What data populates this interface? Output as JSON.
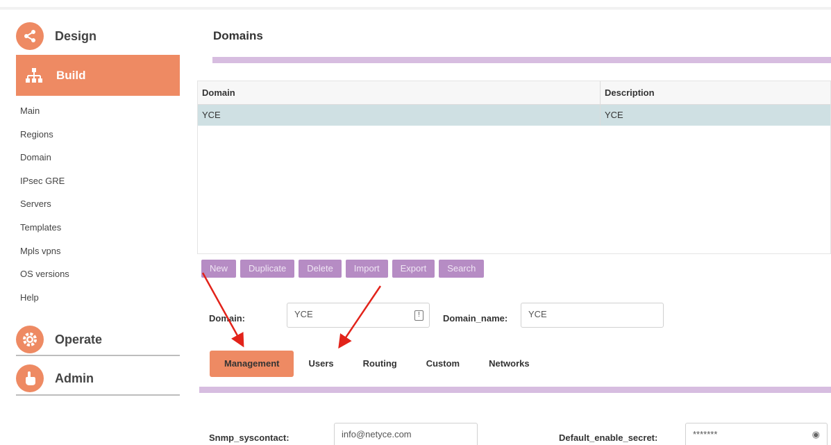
{
  "sidebar": {
    "sections": [
      {
        "label": "Design",
        "icon": "share-icon"
      },
      {
        "label": "Build",
        "icon": "sitemap-icon"
      },
      {
        "label": "Operate",
        "icon": "gear-icon"
      },
      {
        "label": "Admin",
        "icon": "hand-pointer-icon"
      }
    ],
    "menu": [
      "Main",
      "Regions",
      "Domain",
      "IPsec GRE",
      "Servers",
      "Templates",
      "Mpls vpns",
      "OS versions",
      "Help"
    ]
  },
  "page": {
    "title": "Domains"
  },
  "grid": {
    "columns": [
      "Domain",
      "Description"
    ],
    "rows": [
      [
        "YCE",
        "YCE"
      ]
    ]
  },
  "actions": [
    "New",
    "Duplicate",
    "Delete",
    "Import",
    "Export",
    "Search"
  ],
  "form": {
    "domain_label": "Domain:",
    "domain_value": "YCE",
    "domain_name_label": "Domain_name:",
    "domain_name_value": "YCE",
    "snmp_label": "Snmp_syscontact:",
    "snmp_value": "info@netyce.com",
    "secret_label": "Default_enable_secret:",
    "secret_value": "*******"
  },
  "tabs": [
    "Management",
    "Users",
    "Routing",
    "Custom",
    "Networks"
  ],
  "colors": {
    "accent": "#ee8a63",
    "purple": "#b68cc4",
    "purple_bar": "#d7bde0",
    "selected_row": "#cfe0e3",
    "annotation_arrow": "#e2231a"
  }
}
